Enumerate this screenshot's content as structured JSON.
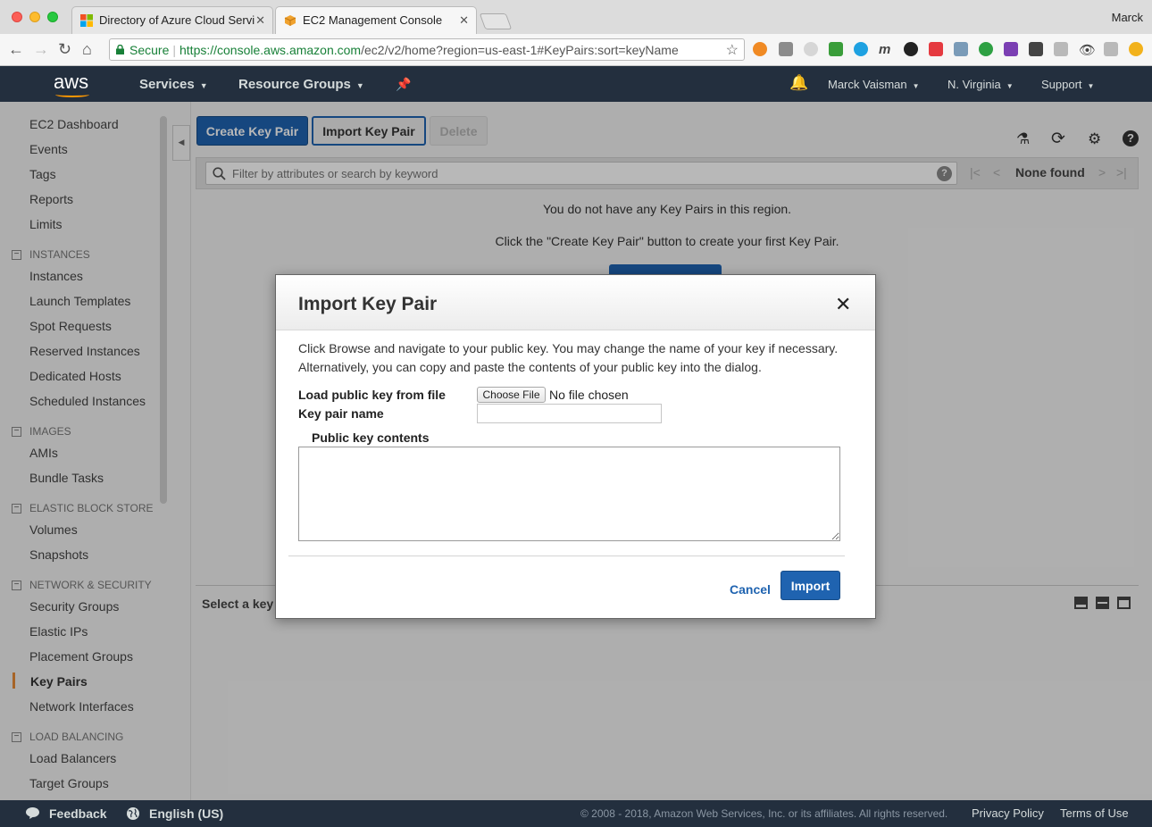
{
  "browser": {
    "tabs": [
      {
        "title": "Directory of Azure Cloud Servi",
        "active": false
      },
      {
        "title": "EC2 Management Console",
        "active": true
      }
    ],
    "profile_name": "Marck",
    "secure_label": "Secure",
    "url_scheme_host": "https://console.aws.amazon.com",
    "url_path": "/ec2/v2/home?region=us-east-1#KeyPairs:sort=keyName"
  },
  "aws_nav": {
    "logo": "aws",
    "services": "Services",
    "resource_groups": "Resource Groups",
    "user": "Marck Vaisman",
    "region": "N. Virginia",
    "support": "Support"
  },
  "sidebar": {
    "top_items": [
      "EC2 Dashboard",
      "Events",
      "Tags",
      "Reports",
      "Limits"
    ],
    "sections": [
      {
        "heading": "INSTANCES",
        "items": [
          "Instances",
          "Launch Templates",
          "Spot Requests",
          "Reserved Instances",
          "Dedicated Hosts",
          "Scheduled Instances"
        ]
      },
      {
        "heading": "IMAGES",
        "items": [
          "AMIs",
          "Bundle Tasks"
        ]
      },
      {
        "heading": "ELASTIC BLOCK STORE",
        "items": [
          "Volumes",
          "Snapshots"
        ]
      },
      {
        "heading": "NETWORK & SECURITY",
        "items": [
          "Security Groups",
          "Elastic IPs",
          "Placement Groups",
          "Key Pairs",
          "Network Interfaces"
        ]
      },
      {
        "heading": "LOAD BALANCING",
        "items": [
          "Load Balancers",
          "Target Groups"
        ]
      }
    ],
    "active_item": "Key Pairs"
  },
  "actions": {
    "create": "Create Key Pair",
    "import": "Import Key Pair",
    "delete": "Delete"
  },
  "filter": {
    "placeholder": "Filter by attributes or search by keyword",
    "status": "None found"
  },
  "empty_state": {
    "line1": "You do not have any Key Pairs in this region.",
    "line2": "Click the \"Create Key Pair\" button to create your first Key Pair."
  },
  "detail_pane": {
    "select_prompt": "Select a key"
  },
  "dialog": {
    "title": "Import Key Pair",
    "description": "Click Browse and navigate to your public key. You may change the name of your key if necessary. Alternatively, you can copy and paste the contents of your public key into the dialog.",
    "load_label": "Load public key from file",
    "choose_file": "Choose File",
    "file_status": "No file chosen",
    "key_name_label": "Key pair name",
    "key_name_value": "",
    "public_key_label": "Public key contents",
    "public_key_value": "",
    "cancel": "Cancel",
    "import": "Import"
  },
  "footer": {
    "feedback": "Feedback",
    "language": "English (US)",
    "copyright": "© 2008 - 2018, Amazon Web Services, Inc. or its affiliates. All rights reserved.",
    "privacy": "Privacy Policy",
    "terms": "Terms of Use"
  },
  "colors": {
    "aws_nav_bg": "#232f3e",
    "primary_button": "#1f63b0",
    "active_accent": "#e78b36"
  }
}
